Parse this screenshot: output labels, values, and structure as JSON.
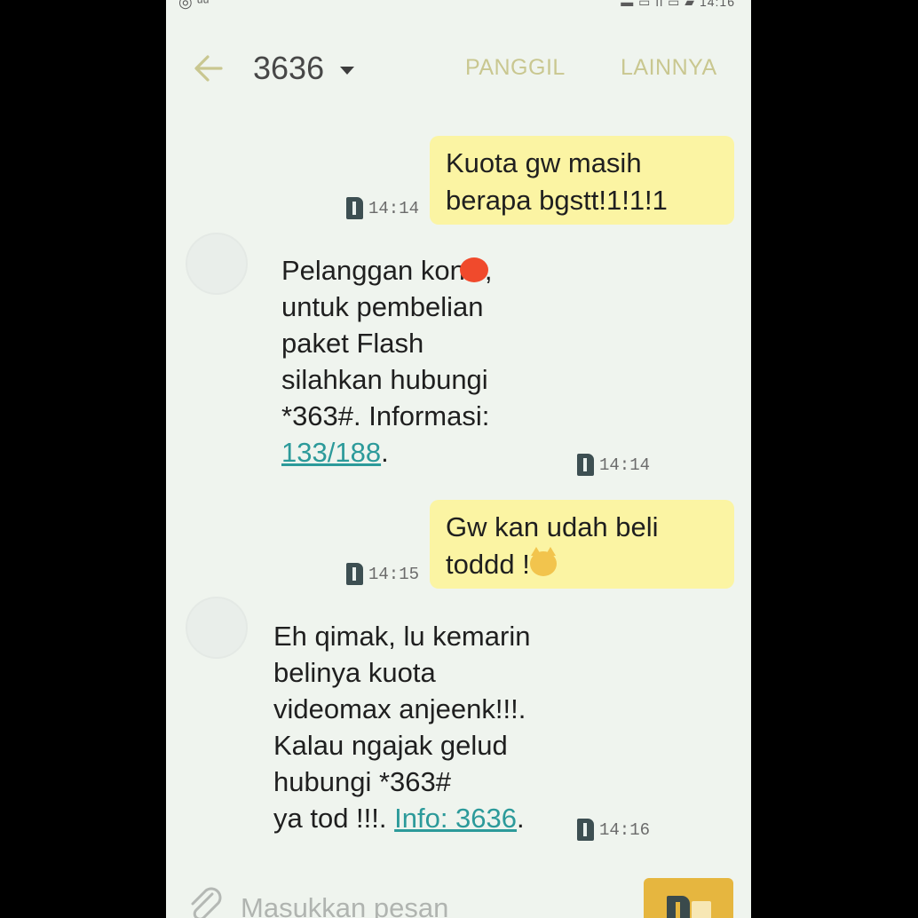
{
  "status_bar": {
    "left_text": "◎ ᵘᵘ",
    "right_text": "▬ ▭   ıl ▭ ▰ 14:16"
  },
  "header": {
    "contact": "3636",
    "call_label": "PANGGIL",
    "more_label": "LAINNYA"
  },
  "messages": [
    {
      "direction": "out",
      "lines": [
        "Kuota gw masih",
        "berapa bgstt!1!1!1"
      ],
      "time": "14:14"
    },
    {
      "direction": "in",
      "line1_before": "Pelanggan kon",
      "line1_after": ",",
      "lines": [
        "untuk pembelian",
        "paket Flash",
        "silahkan hubungi",
        "*363#. Informasi:"
      ],
      "link": "133/188",
      "link_suffix": ".",
      "time": "14:14"
    },
    {
      "direction": "out",
      "line1": "Gw kan udah beli",
      "line2": "toddd !",
      "time": "14:15"
    },
    {
      "direction": "in",
      "lines": [
        "Eh qimak, lu kemarin",
        "belinya kuota",
        "videomax anjeenk!!!.",
        "Kalau ngajak gelud",
        "hubungi *363#"
      ],
      "last_line": "ya tod !!!. ",
      "link": "Info: 3636",
      "link_suffix": ".",
      "time": "14:16"
    }
  ],
  "composer": {
    "placeholder": "Masukkan pesan"
  },
  "icons": {
    "back": "arrow-left-icon",
    "caret": "caret-down-icon",
    "sim": "sim-card-icon",
    "attach": "paperclip-icon",
    "send": "send-sim-icon"
  },
  "colors": {
    "outgoing_bubble": "#fbf4a3",
    "background": "#eff4ee",
    "link": "#2c9a9a",
    "header_button": "#c9c790",
    "send_button": "#e6b63f"
  }
}
